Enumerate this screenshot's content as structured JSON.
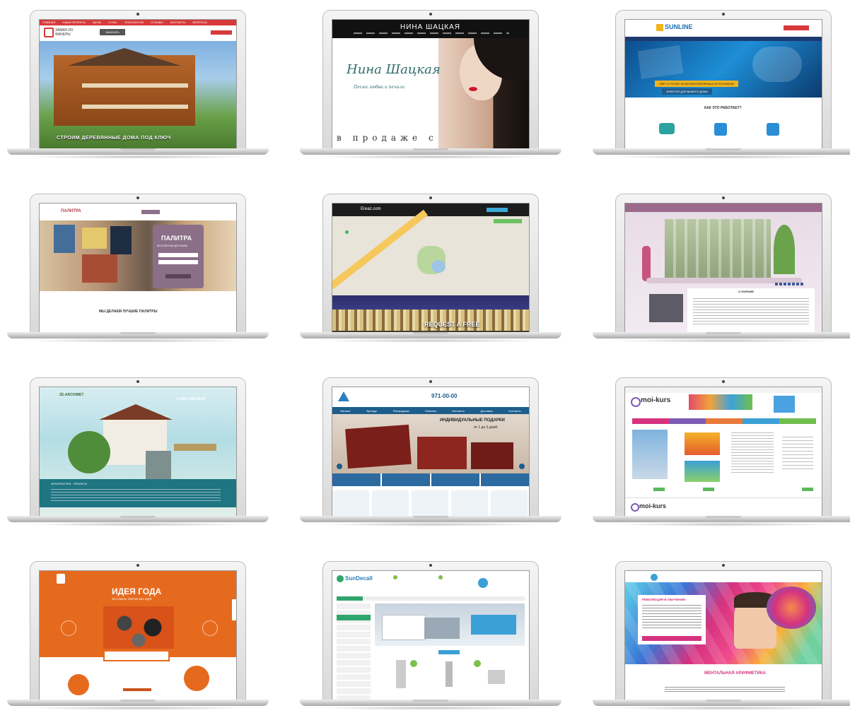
{
  "colors": {
    "brick_red": "#d73a3a",
    "sunline_blue": "#1b6fb5",
    "orange": "#e66a1e",
    "teal": "#1f7582",
    "navy": "#1d5d8c",
    "pink": "#d6337f"
  },
  "laptops": [
    {
      "name": "laptop-1",
      "nav": [
        "ГЛАВНАЯ",
        "НАШИ ПРОЕКТЫ",
        "ЦЕНЫ",
        "О НАС",
        "ТЕХНОЛОГИИ",
        "ОТЗЫВЫ",
        "КОНТАКТЫ",
        "ВОПРОСЫ"
      ],
      "logo": "ЗАМКИ ИЗ ФАНЕРЫ",
      "button": "ЗАКАЗАТЬ",
      "tagline": "СТРОИМ ДЕРЕВЯННЫЕ ДОМА ПОД КЛЮЧ"
    },
    {
      "name": "laptop-2",
      "header": "НИНА ШАЦКАЯ",
      "script_title": "Нина Шацкая",
      "script_sub": "Песни любви и печали",
      "bottom_text": "в продаже с"
    },
    {
      "name": "laptop-3",
      "logo": "SUNLINE",
      "banner1": "СВЕТ И ТЕПЛО ИЗ ВОЗОБНОВЛЯЕМЫХ ИСТОЧНИКОВ",
      "banner2": "ЭНЕРГИЯ ДЛЯ ВАШЕГО ДОМА",
      "section": "КАК ЭТО РАБОТАЕТ?"
    },
    {
      "name": "laptop-4",
      "logo": "ПАЛИТРА",
      "card_title": "ПАЛИТРА",
      "card_sub": "БЕСПЛАТНАЯ ДОСТАВКА",
      "heading": "МЫ ДЕЛАЕМ ЛУЧШИЕ ПАЛИТРЫ"
    },
    {
      "name": "laptop-5",
      "logo": "Ereaz.com",
      "bottom": "REQUEST A FREE"
    },
    {
      "name": "laptop-6",
      "title": "О ФИЛЬМЕ"
    },
    {
      "name": "laptop-7",
      "phone": "8 (495) 640-00-00",
      "logo": "ZE-ARCHIMET",
      "bar_text": "АРХИТЕКТУРА · ПРОЕКТЫ"
    },
    {
      "name": "laptop-8",
      "phone": "971-00-00",
      "nav": [
        "Каталог",
        "Бренды",
        "Распродажа",
        "Новинки",
        "Контакты",
        "Доставка",
        "Контакты"
      ],
      "slogan": "ИНДИВИДУАЛЬНЫЕ ПОДАРКИ",
      "slogan_sub": "от 1 до 3 дней"
    },
    {
      "name": "laptop-9",
      "logo": "moi-kurs",
      "footer_logo": "moi-kurs"
    },
    {
      "name": "laptop-10",
      "title": "ИДЕЯ ГОДА",
      "subtitle": "ФЕСТИВАЛЬ ТВОРЧЕСКИХ ИДЕЙ"
    },
    {
      "name": "laptop-11",
      "logo": "SunDecall"
    },
    {
      "name": "laptop-12",
      "title": "МЕНТАЛЬНАЯ АРИФМЕТИКА",
      "box_title": "РЕВОЛЮЦИЯ В ОБУЧЕНИИ"
    }
  ]
}
